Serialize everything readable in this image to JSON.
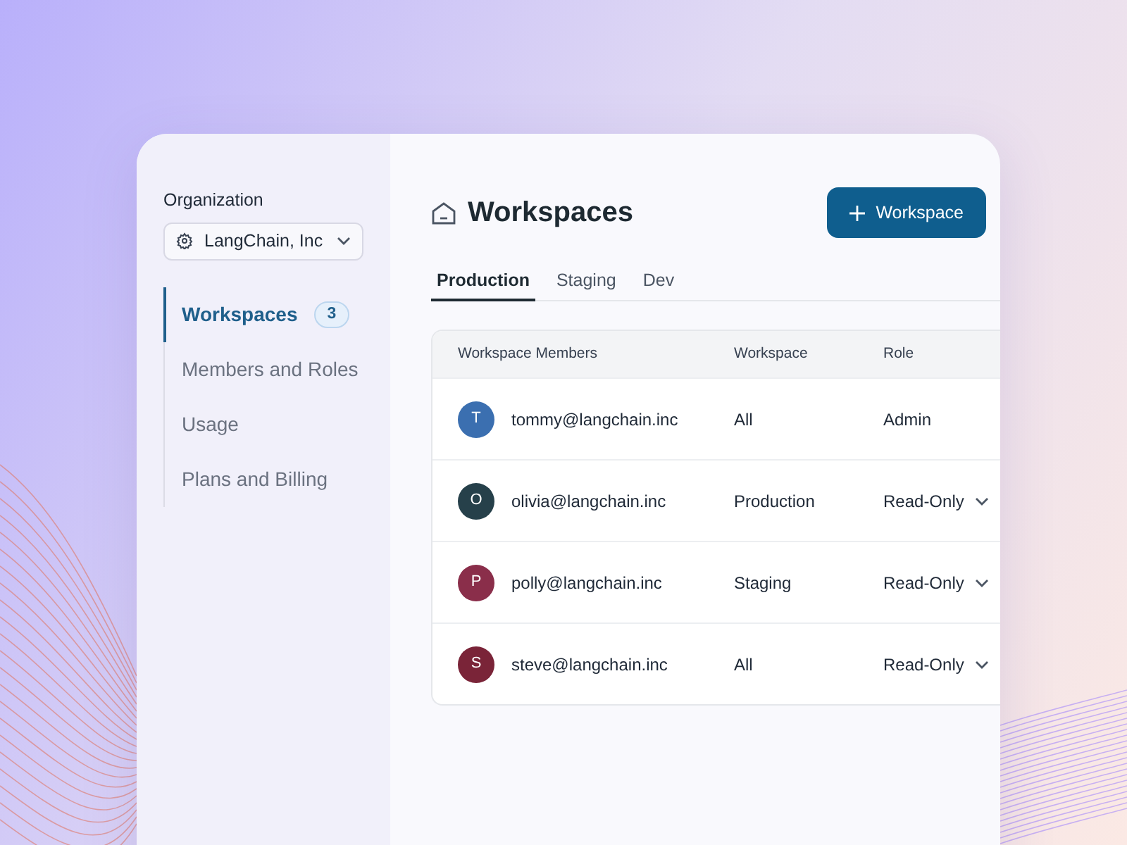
{
  "sidebar": {
    "org_label": "Organization",
    "org_select": {
      "value": "LangChain, Inc"
    },
    "items": [
      {
        "label": "Workspaces",
        "badge": "3",
        "selected": true
      },
      {
        "label": "Members and Roles",
        "selected": false
      },
      {
        "label": "Usage",
        "selected": false
      },
      {
        "label": "Plans and Billing",
        "selected": false
      }
    ]
  },
  "header": {
    "title": "Workspaces",
    "button": "Workspace"
  },
  "tabs": [
    {
      "label": "Production",
      "selected": true
    },
    {
      "label": "Staging",
      "selected": false
    },
    {
      "label": "Dev",
      "selected": false
    }
  ],
  "table": {
    "columns": [
      "Workspace Members",
      "Workspace",
      "Role"
    ],
    "rows": [
      {
        "initial": "T",
        "color": "#3b6fb0",
        "email": "tommy@langchain.inc",
        "workspace": "All",
        "role": "Admin",
        "kind": "static"
      },
      {
        "initial": "O",
        "color": "#26404a",
        "email": "olivia@langchain.inc",
        "workspace": "Production",
        "role": "Read-Only",
        "kind": "dropdown"
      },
      {
        "initial": "P",
        "color": "#8a2e4a",
        "email": "polly@langchain.inc",
        "workspace": "Staging",
        "role": "Read-Only",
        "kind": "dropdown"
      },
      {
        "initial": "S",
        "color": "#7a2438",
        "email": "steve@langchain.inc",
        "workspace": "All",
        "role": "Read-Only",
        "kind": "dropdown"
      }
    ]
  }
}
